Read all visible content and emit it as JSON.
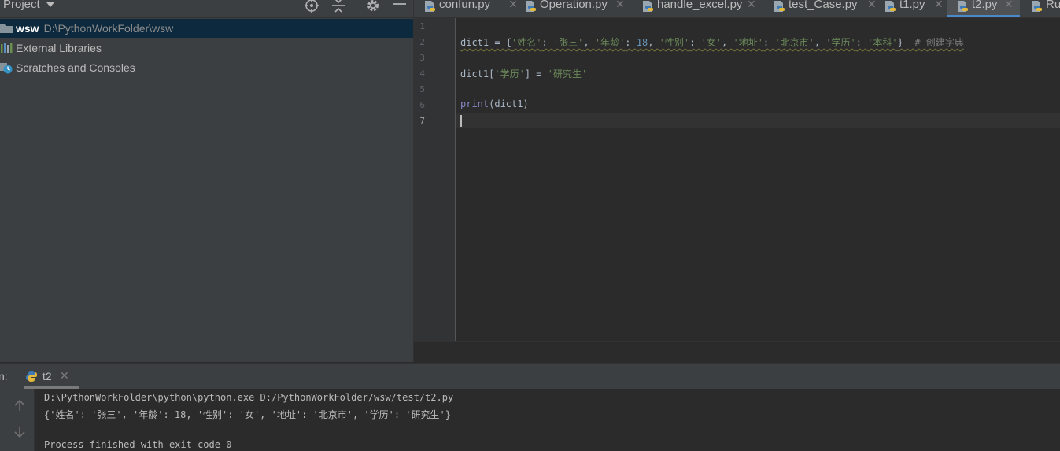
{
  "project": {
    "title": "Project",
    "tree": [
      {
        "name": "wsw",
        "path": "D:\\PythonWorkFolder\\wsw"
      },
      {
        "name": "External Libraries"
      },
      {
        "name": "Scratches and Consoles"
      }
    ]
  },
  "tabs": [
    {
      "label": "confun.py"
    },
    {
      "label": "Operation.py"
    },
    {
      "label": "handle_excel.py"
    },
    {
      "label": "test_Case.py"
    },
    {
      "label": "t1.py"
    },
    {
      "label": "t2.py"
    },
    {
      "label": "Ru"
    }
  ],
  "editor": {
    "line_numbers": [
      "1",
      "2",
      "3",
      "4",
      "5",
      "6",
      "7"
    ],
    "line2": {
      "a": "dict1 = {",
      "k1": "'姓名'",
      "s1": ": ",
      "v1": "'张三'",
      "c1": ", ",
      "k2": "'年龄'",
      "s2": ": ",
      "v2": "18",
      "c2": ", ",
      "k3": "'性别'",
      "s3": ": ",
      "v3": "'女'",
      "c3": ", ",
      "k4": "'地址'",
      "s4": ": ",
      "v4": "'北京市'",
      "c4": ", ",
      "k5": "'学历'",
      "s5": ": ",
      "v5": "'本科'",
      "end": "}",
      "comment": "# 创建字典"
    },
    "line4": {
      "a": "dict1[",
      "key": "'学历'",
      "b": "] = ",
      "val": "'研究生'"
    },
    "line6": {
      "fn": "print",
      "args": "(dict1)"
    }
  },
  "run": {
    "label": "n:",
    "tab": "t2",
    "output": [
      "D:\\PythonWorkFolder\\python\\python.exe D:/PythonWorkFolder/wsw/test/t2.py",
      "{'姓名': '张三', '年龄': 18, '性别': '女', '地址': '北京市', '学历': '研究生'}",
      "",
      "Process finished with exit code 0"
    ]
  },
  "colors": {
    "background": "#2b2b2b",
    "panel": "#3c3f41",
    "selection": "#0d293e",
    "string": "#6a8759",
    "number": "#6897bb",
    "comment": "#808080",
    "accent": "#4a88c7"
  }
}
